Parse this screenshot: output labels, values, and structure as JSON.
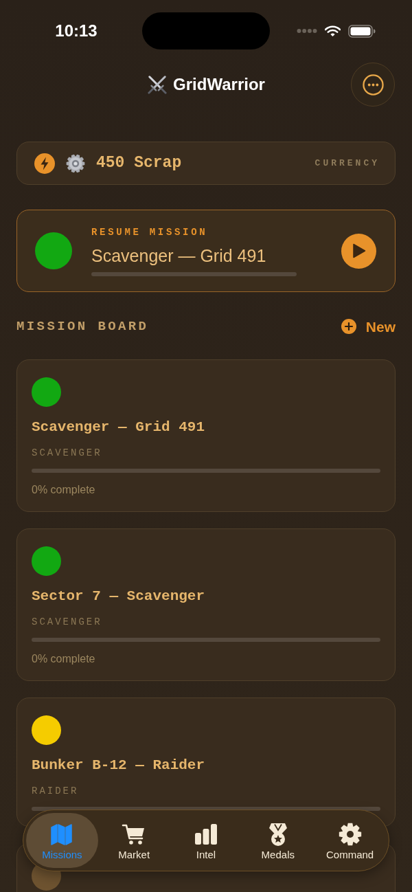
{
  "status_bar": {
    "time": "10:13"
  },
  "header": {
    "title": "GridWarrior"
  },
  "currency": {
    "amount": "450 Scrap",
    "label": "CURRENCY"
  },
  "resume": {
    "label": "RESUME MISSION",
    "title": "Scavenger — Grid 491",
    "color": "#12a812",
    "level": 0
  },
  "mission_board": {
    "title": "MISSION BOARD",
    "new_label": "New"
  },
  "missions": [
    {
      "color": "#12a812",
      "title": "Scavenger — Grid 491",
      "type": "SCAVENGER",
      "level": 0,
      "progress": "0% complete"
    },
    {
      "color": "#12a812",
      "title": "Sector 7 — Scavenger",
      "type": "SCAVENGER",
      "level": 0,
      "progress": "0% complete"
    },
    {
      "color": "#f5cc00",
      "title": "Bunker B-12 — Raider",
      "type": "RAIDER",
      "level": 0
    },
    {
      "color": "#6e5330"
    }
  ],
  "tab_bar": {
    "tabs": [
      {
        "label": "Missions",
        "selected": true
      },
      {
        "label": "Market",
        "selected": false
      },
      {
        "label": "Intel",
        "selected": false
      },
      {
        "label": "Medals",
        "selected": false
      },
      {
        "label": "Command",
        "selected": false
      }
    ]
  }
}
